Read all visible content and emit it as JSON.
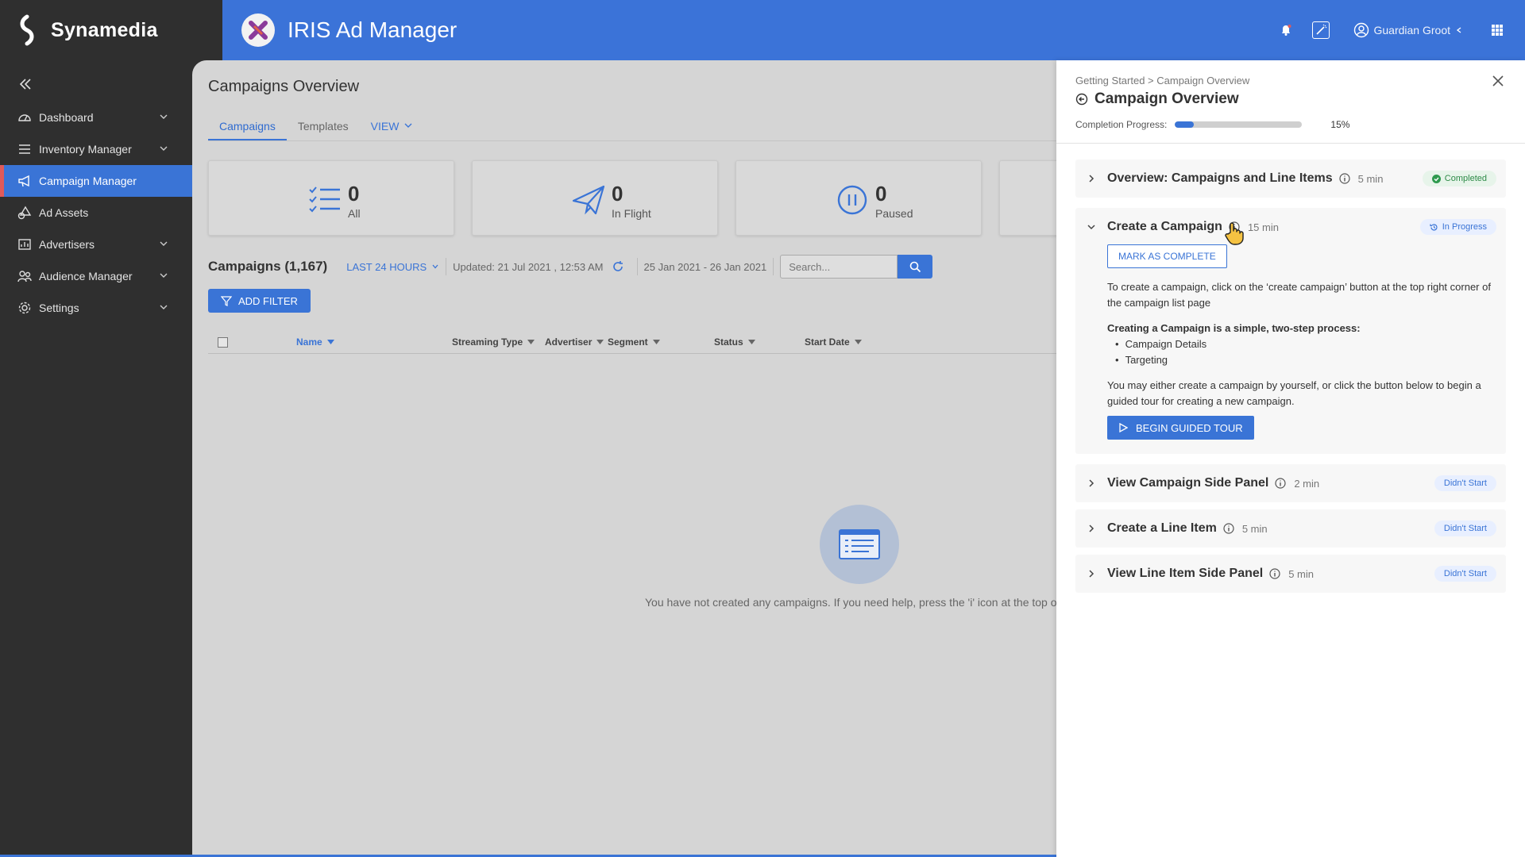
{
  "brand": {
    "name": "Synamedia"
  },
  "app": {
    "title": "IRIS Ad Manager"
  },
  "user": {
    "name": "Guardian Groot"
  },
  "sidebar": {
    "items": [
      {
        "label": "Dashboard",
        "icon": "dashboard-icon",
        "expandable": true
      },
      {
        "label": "Inventory Manager",
        "icon": "list-icon",
        "expandable": true
      },
      {
        "label": "Campaign Manager",
        "icon": "megaphone-icon",
        "expandable": false,
        "active": true
      },
      {
        "label": "Ad Assets",
        "icon": "shapes-icon",
        "expandable": false
      },
      {
        "label": "Advertisers",
        "icon": "chart-icon",
        "expandable": true
      },
      {
        "label": "Audience Manager",
        "icon": "people-icon",
        "expandable": true
      },
      {
        "label": "Settings",
        "icon": "gear-icon",
        "expandable": true
      }
    ]
  },
  "main": {
    "title": "Campaigns Overview",
    "tabs": [
      {
        "label": "Campaigns"
      },
      {
        "label": "Templates"
      },
      {
        "label": "VIEW"
      }
    ],
    "cards": [
      {
        "value": "0",
        "label": "All"
      },
      {
        "value": "0",
        "label": "In Flight"
      },
      {
        "value": "0",
        "label": "Paused"
      }
    ],
    "count_label": "Campaigns (1,167)",
    "range": "LAST 24 HOURS",
    "updated": "Updated: 21 Jul 2021 , 12:53 AM",
    "date_range": "25 Jan 2021 - 26 Jan 2021",
    "search_placeholder": "Search...",
    "add_filter": "ADD FILTER",
    "columns": [
      "Name",
      "Streaming Type",
      "Advertiser",
      "Segment",
      "Status",
      "Start Date"
    ],
    "empty_text": "You have not created any campaigns. If you need help, press the 'i' icon at the top of this p"
  },
  "panel": {
    "breadcrumb": "Getting Started > Campaign Overview",
    "title": "Campaign Overview",
    "progress_label": "Completion Progress:",
    "progress_value": 15,
    "progress_text": "15%",
    "steps": [
      {
        "title": "Overview: Campaigns and Line Items",
        "time": "5 min",
        "status": "Completed"
      },
      {
        "title": "Create a Campaign",
        "time": "15 min",
        "status": "In Progress"
      },
      {
        "title": "View Campaign Side Panel",
        "time": "2 min",
        "status": "Didn't Start"
      },
      {
        "title": "Create a Line Item",
        "time": "5 min",
        "status": "Didn't Start"
      },
      {
        "title": "View Line Item Side Panel",
        "time": "5 min",
        "status": "Didn't Start"
      }
    ],
    "mark_complete": "MARK AS COMPLETE",
    "body_p1": "To create a campaign, click on the ‘create campaign’ button at the top right corner of the campaign list page",
    "body_bold": "Creating a Campaign is a simple, two-step process:",
    "body_list": [
      "Campaign Details",
      "Targeting"
    ],
    "body_p2": "You may either create a campaign by yourself, or click the button below to begin a guided tour for creating a new campaign.",
    "tour_button": "BEGIN GUIDED TOUR"
  },
  "colors": {
    "accent": "#3a74d6",
    "sidebar": "#2f2f2f",
    "active_marker": "#e05a5a",
    "completed": "#2e8b48"
  }
}
